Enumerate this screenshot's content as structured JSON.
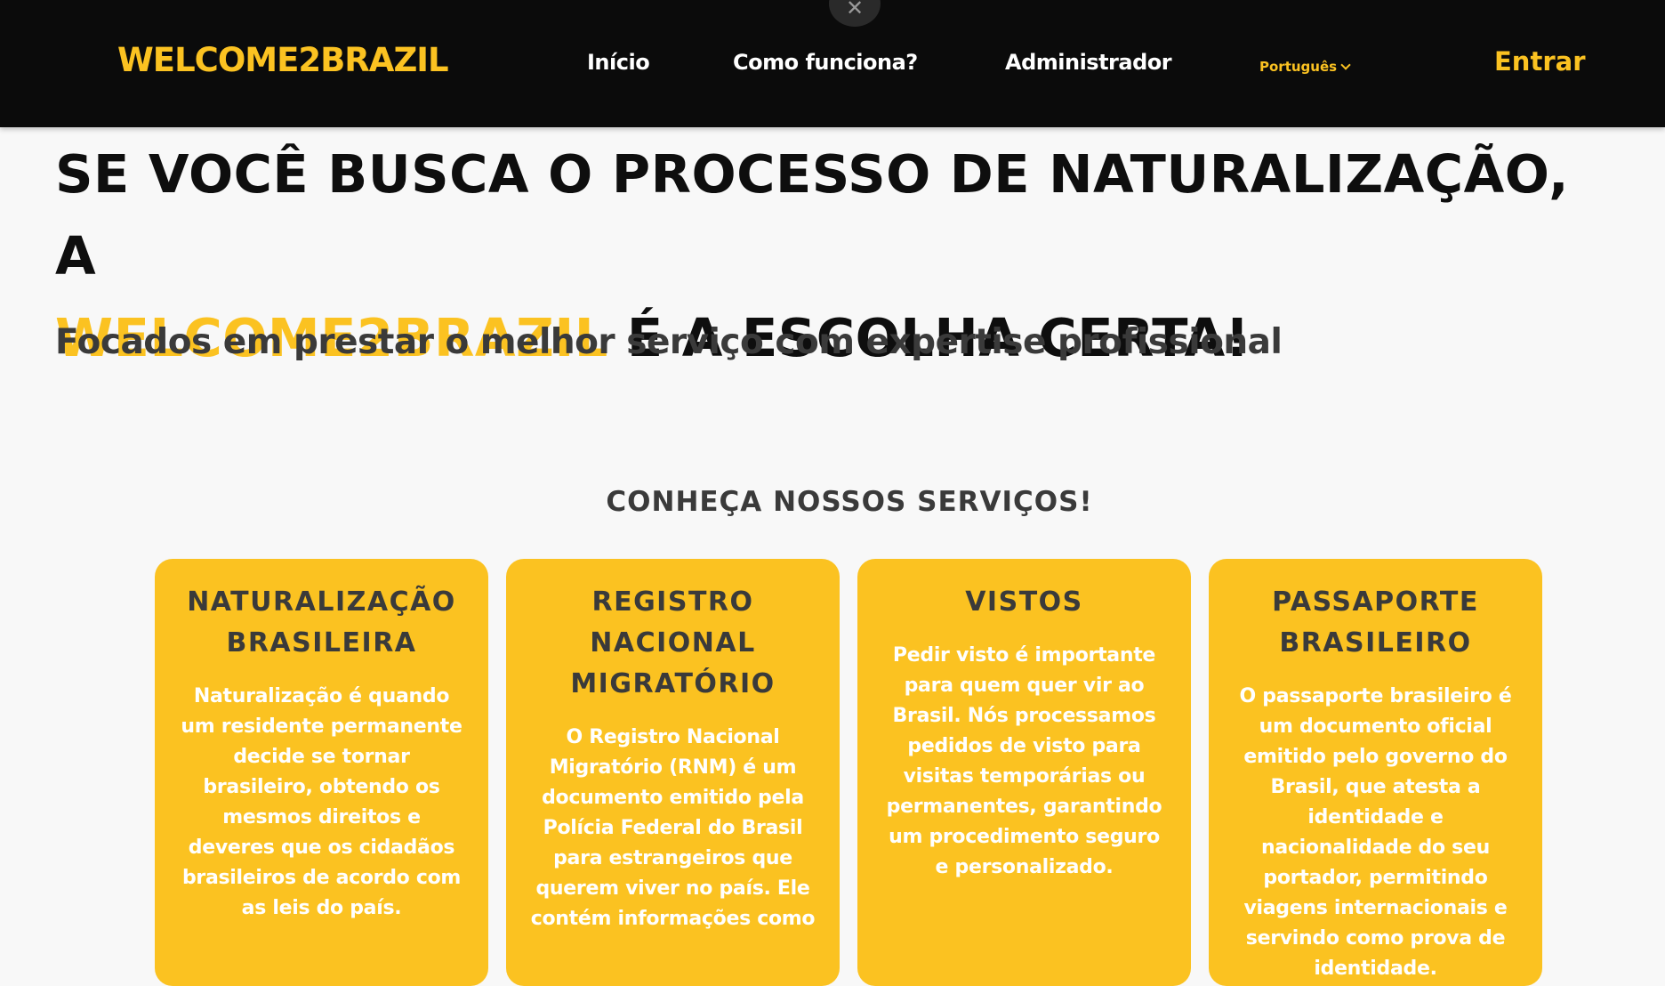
{
  "nav": {
    "brand": "WELCOME2BRAZIL",
    "close_symbol": "✕",
    "links": [
      "Início",
      "Como funciona?",
      "Administrador"
    ],
    "language": "Português",
    "login": "Entrar"
  },
  "hero": {
    "line1": "SE VOCÊ BUSCA O PROCESSO DE NATURALIZAÇÃO, A",
    "highlight": "WELCOME2BRAZIL",
    "line2": " É A ESCOLHA CERTA!",
    "subtitle": "Focados em prestar o melhor serviço com expertise profissional"
  },
  "services": {
    "title": "CONHEÇA NOSSOS SERVIÇOS!",
    "cards": [
      {
        "title": "NATURALIZAÇÃO BRASILEIRA",
        "text": "Naturalização é quando um residente permanente decide se tornar brasileiro, obtendo os mesmos direitos e deveres que os cidadãos brasileiros de acordo com as leis do país."
      },
      {
        "title": "REGISTRO NACIONAL MIGRATÓRIO",
        "text": "O Registro Nacional Migratório (RNM) é um documento emitido pela Polícia Federal do Brasil para estrangeiros que querem viver no país. Ele contém informações como"
      },
      {
        "title": "VISTOS",
        "text": "Pedir visto é importante para quem quer vir ao Brasil. Nós processamos pedidos de visto para visitas temporárias ou permanentes, garantindo um procedimento seguro e personalizado."
      },
      {
        "title": "PASSAPORTE BRASILEIRO",
        "text": "O passaporte brasileiro é um documento oficial emitido pelo governo do Brasil, que atesta a identidade e nacionalidade do seu portador, permitindo viagens internacionais e servindo como prova de identidade."
      }
    ]
  },
  "colors": {
    "accent": "#fbc221",
    "navbar_bg": "#0b0b0b",
    "page_bg": "#f8f8f8",
    "heading_text": "#0e0e0e",
    "card_title_text": "#3a3a3a",
    "card_body_text": "#ffffff"
  },
  "icons": {
    "close": "close-icon",
    "language_dropdown": "chevron-down-icon"
  }
}
